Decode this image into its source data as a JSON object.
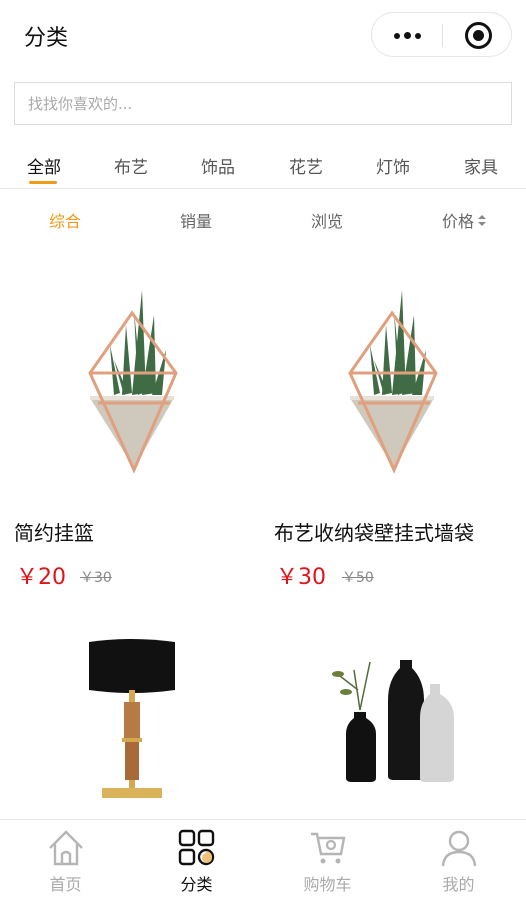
{
  "navbar": {
    "title": "分类"
  },
  "search": {
    "placeholder": "找找你喜欢的..."
  },
  "tabs": [
    {
      "label": "全部",
      "active": true
    },
    {
      "label": "布艺"
    },
    {
      "label": "饰品"
    },
    {
      "label": "花艺"
    },
    {
      "label": "灯饰"
    },
    {
      "label": "家具"
    }
  ],
  "sort": [
    {
      "label": "综合",
      "active": true
    },
    {
      "label": "销量"
    },
    {
      "label": "浏览"
    },
    {
      "label": "价格"
    }
  ],
  "products": [
    {
      "name": "简约挂篮",
      "price": "￥20",
      "old_price": "￥30",
      "image": "hanging-planter"
    },
    {
      "name": "布艺收纳袋壁挂式墙袋",
      "price": "￥30",
      "old_price": "￥50",
      "image": "hanging-planter"
    },
    {
      "name": "",
      "price": "",
      "old_price": "",
      "image": "table-lamp"
    },
    {
      "name": "",
      "price": "",
      "old_price": "",
      "image": "vases"
    }
  ],
  "tabbar": [
    {
      "label": "首页",
      "icon": "home-icon"
    },
    {
      "label": "分类",
      "icon": "category-icon",
      "active": true
    },
    {
      "label": "购物车",
      "icon": "cart-icon"
    },
    {
      "label": "我的",
      "icon": "user-icon"
    }
  ],
  "colors": {
    "accent": "#f19a1a",
    "price": "#e0141b"
  }
}
